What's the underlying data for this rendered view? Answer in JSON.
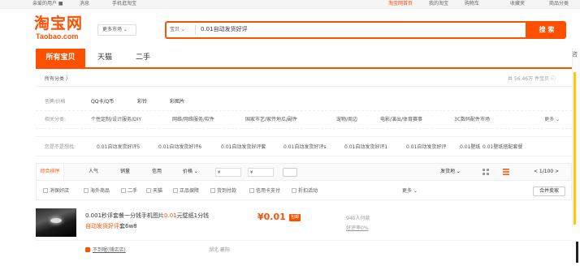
{
  "topbar": {
    "left_items": [
      "亲爱的用户 ■",
      "消息",
      "手机逛淘宝"
    ],
    "right_items": [
      "淘宝网首页",
      "我的淘宝",
      "购物车",
      "收藏夹",
      "商品分类"
    ]
  },
  "logo": {
    "cn": "淘宝网",
    "en": "Taobao.com"
  },
  "market_button": "更多市场 ⌄",
  "search": {
    "category": "宝贝 ⌄",
    "value": "0.01自动发货好评",
    "button": "搜 索"
  },
  "tabs": [
    {
      "label": "所有宝贝"
    },
    {
      "label": "天猫"
    },
    {
      "label": "二手"
    }
  ],
  "right_panel_label": "咨",
  "breadcrumb": "所有分类 〉",
  "result_count": "共 56.46万 件宝贝 ⓘ",
  "filters": [
    {
      "label": "품牌/价格",
      "items": [
        "QQ卡/Q币",
        "彩铃",
        "彩图片"
      ]
    },
    {
      "label": "相关分类:",
      "items": [
        "个性定制/设计服务/DIY",
        "网络/网络服务/软件",
        "国家市艺/家传地瓜/副件",
        "宠物/周边",
        "电影/演出/体育赛事",
        "3C数码配件市场"
      ],
      "more": "更多 ⌄"
    }
  ],
  "related": {
    "label": "您是不是想找:",
    "items": [
      "0.01自动发货好评5",
      "0.01自动发货好评6",
      "0.01自动发货好评套",
      "0.01自动发货好评s",
      "0.01自动发货好评1",
      "0.01自动发货好评",
      "0.01壁纸",
      "0.01壁纸搭配套餐"
    ]
  },
  "sort": {
    "items": [
      "综合排序",
      "人气",
      "销量",
      "信用",
      "价格 ⌄"
    ],
    "price_min_placeholder": "¥",
    "price_max_placeholder": "¥",
    "ship_from": "发货地 ⌄",
    "pager": "< 1/100 >"
  },
  "checkboxes": [
    "消保好店",
    "海外商品",
    "二手",
    "天猫",
    "正品保障",
    "货到付款",
    "信用卡支付",
    "折扣活动"
  ],
  "more_label": "更多 ⌄",
  "fold_label": "合并卖家",
  "item": {
    "title_prefix": "0.001秒评套餐一分钱手机图片",
    "title_highlight": "0.01",
    "title_suffix": "元壁纸1分钱",
    "title2_highlight": "自动发货好评",
    "title2_suffix": "套6w8",
    "price": "¥0.01",
    "badge": "包邮",
    "sold": "940人付款",
    "rating": "好评率0%",
    "shop": "不到喔(铺店店)",
    "location": "湖北 襄阳"
  },
  "colors": {
    "accent": "#ff5000",
    "highlight": "#ffc900"
  }
}
